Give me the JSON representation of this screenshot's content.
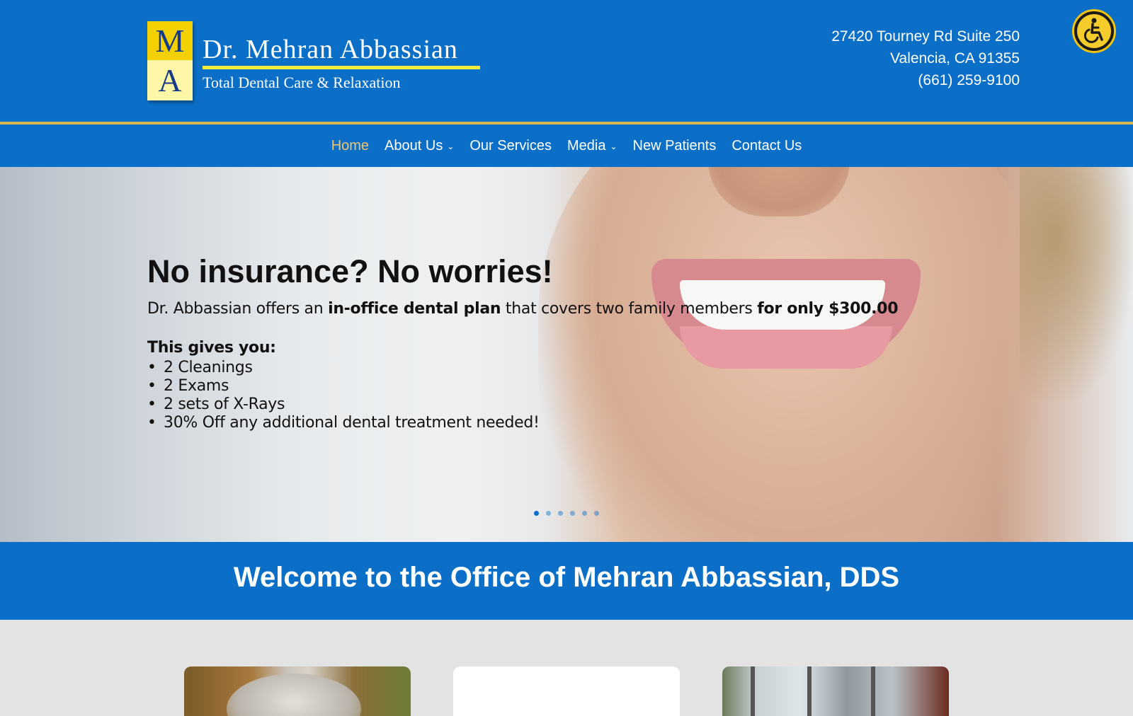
{
  "header": {
    "logo_letters": [
      "M",
      "A"
    ],
    "logo_name": "Dr. Mehran Abbassian",
    "logo_tagline": "Total Dental Care & Relaxation",
    "address_line1": "27420 Tourney Rd Suite 250",
    "address_line2": "Valencia, CA 91355",
    "phone": "(661) 259-9100",
    "accessibility_icon": "wheelchair-icon"
  },
  "nav": {
    "items": [
      {
        "label": "Home",
        "active": true
      },
      {
        "label": "About Us",
        "dropdown": true
      },
      {
        "label": "Our Services"
      },
      {
        "label": "Media",
        "dropdown": true
      },
      {
        "label": "New Patients"
      },
      {
        "label": "Contact Us"
      }
    ]
  },
  "hero": {
    "title": "No insurance? No worries!",
    "desc_part1": "Dr. Abbassian offers an ",
    "desc_bold1": "in-office dental plan",
    "desc_part2": " that covers two family members ",
    "desc_bold2": "for only $300.00",
    "subheading": "This gives you:",
    "bullets": [
      "2 Cleanings",
      "2 Exams",
      "2 sets of X-Rays",
      "30% Off any additional dental treatment needed!"
    ],
    "slide_count": 6,
    "active_slide": 1
  },
  "welcome": {
    "title": "Welcome to the Office of Mehran Abbassian, DDS"
  },
  "colors": {
    "brand_blue": "#0b6fc7",
    "accent_gold": "#d9b64e",
    "logo_yellow": "#f3d000",
    "active_nav": "#f4c46c"
  }
}
